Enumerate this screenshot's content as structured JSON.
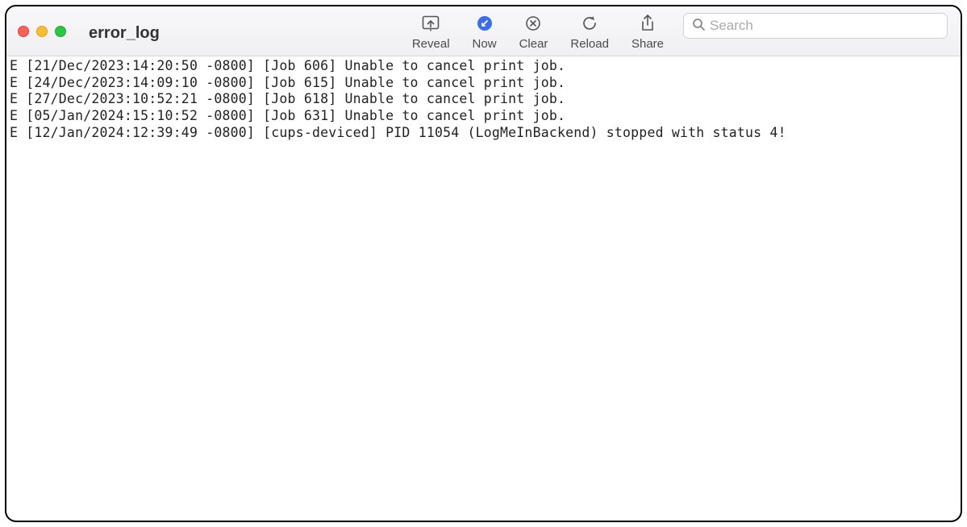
{
  "window": {
    "title": "error_log"
  },
  "toolbar": {
    "reveal": {
      "label": "Reveal"
    },
    "now": {
      "label": "Now"
    },
    "clear": {
      "label": "Clear"
    },
    "reload": {
      "label": "Reload"
    },
    "share": {
      "label": "Share"
    }
  },
  "search": {
    "placeholder": "Search"
  },
  "log_lines": [
    "E [21/Dec/2023:14:20:50 -0800] [Job 606] Unable to cancel print job.",
    "E [24/Dec/2023:14:09:10 -0800] [Job 615] Unable to cancel print job.",
    "E [27/Dec/2023:10:52:21 -0800] [Job 618] Unable to cancel print job.",
    "E [05/Jan/2024:15:10:52 -0800] [Job 631] Unable to cancel print job.",
    "E [12/Jan/2024:12:39:49 -0800] [cups-deviced] PID 11054 (LogMeInBackend) stopped with status 4!"
  ]
}
